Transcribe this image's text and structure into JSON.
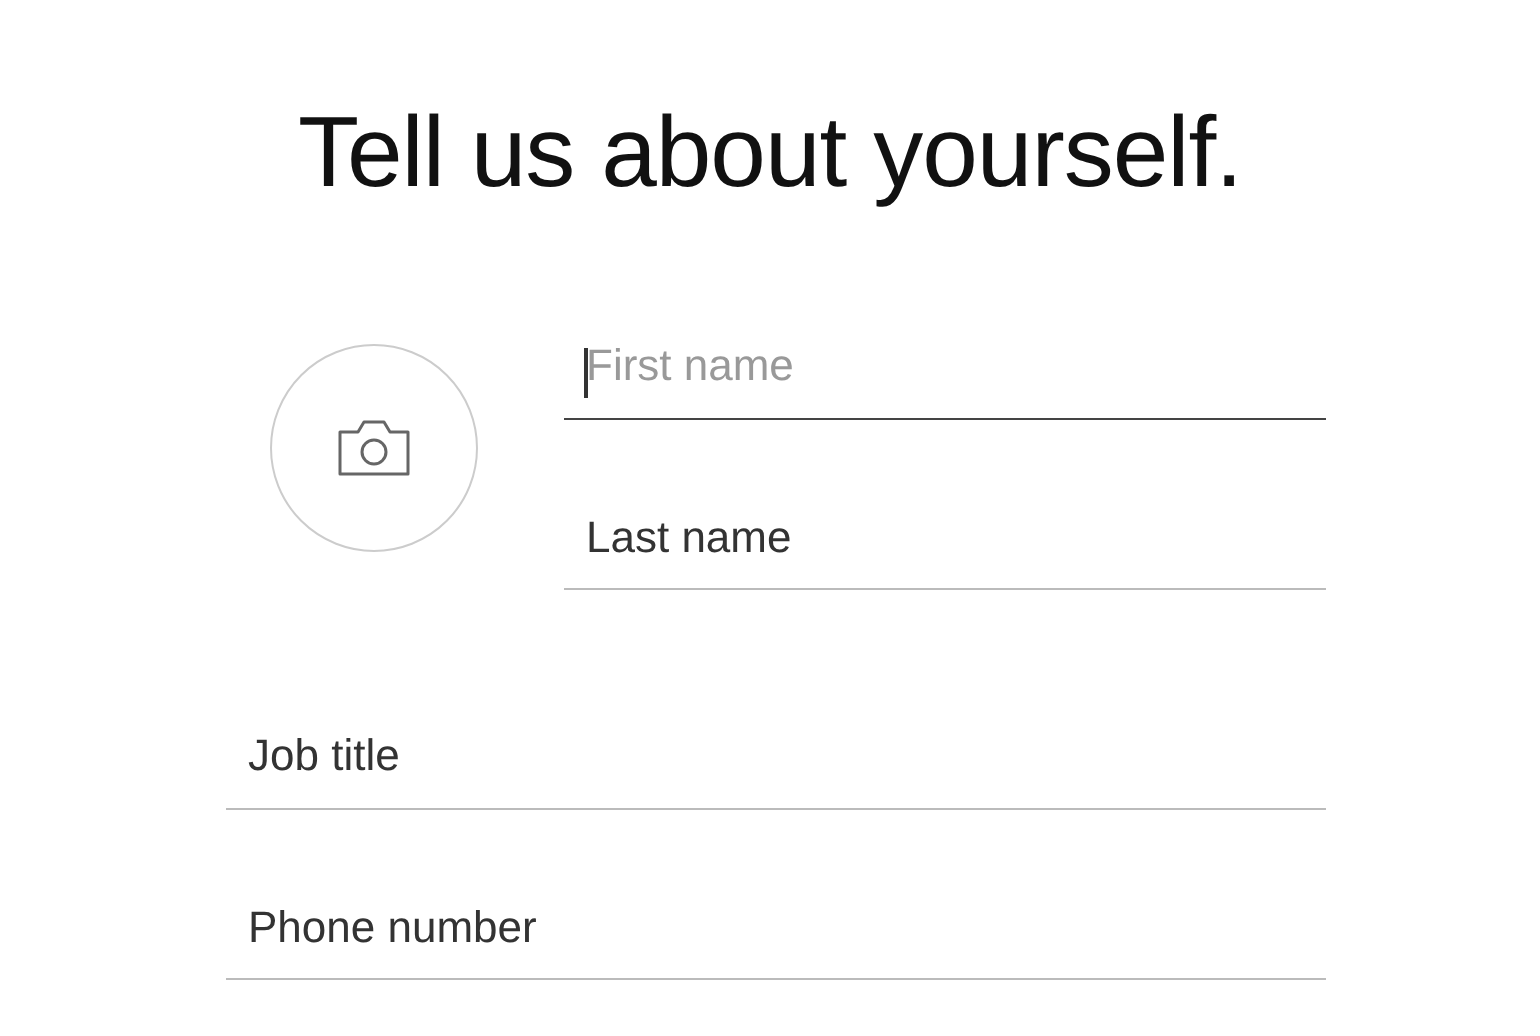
{
  "title": "Tell us about yourself.",
  "fields": [
    {
      "placeholder": "First name",
      "focused": true
    },
    {
      "placeholder": "Last name",
      "focused": false
    },
    {
      "placeholder": "Job title",
      "focused": false
    },
    {
      "placeholder": "Phone number",
      "focused": false
    }
  ]
}
